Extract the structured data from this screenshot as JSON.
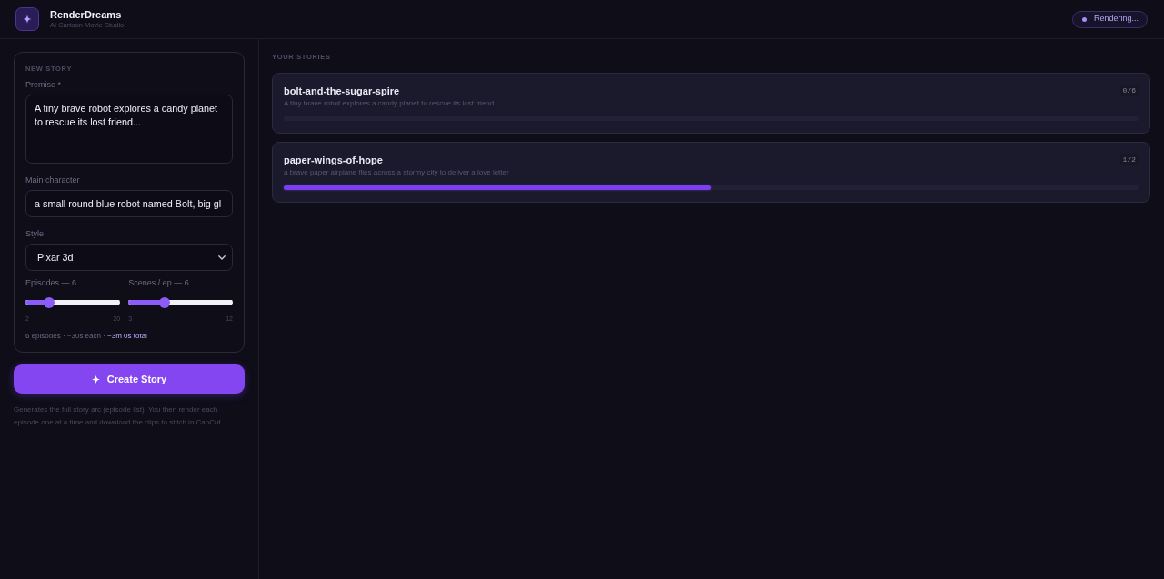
{
  "header": {
    "app_name": "RenderDreams",
    "tagline": "AI Cartoon Movie Studio",
    "status": "Rendering..."
  },
  "new_story": {
    "heading": "NEW STORY",
    "fields": [
      {
        "kind": "textarea",
        "label": "Premise *",
        "value": "A tiny brave robot explores a candy planet to rescue its lost friend..."
      },
      {
        "kind": "text",
        "label": "Main character",
        "value": "a small round blue robot named Bolt, big gl"
      },
      {
        "kind": "select",
        "label": "Style",
        "value": "Pixar 3d"
      }
    ],
    "sliders": [
      {
        "label": "Episodes — 6",
        "level": 0.22,
        "min": "2",
        "max": "20"
      },
      {
        "label": "Scenes / ep — 6",
        "level": 0.33,
        "min": "3",
        "max": "12"
      }
    ],
    "summary": "6 episodes · ~30s each · **~3m 0s total**"
  },
  "create_button": "Create Story",
  "help_text": "Generates the full story arc (episode list). You then render each episode one at a time and download the clips to stitch in CapCut.",
  "stories": {
    "heading": "YOUR STORIES",
    "items": [
      {
        "title": "bolt-and-the-sugar-spire",
        "description": "A tiny brave robot explores a candy planet to rescue its lost friend...",
        "progress": "0/6",
        "level": 0
      },
      {
        "title": "paper-wings-of-hope",
        "description": "a brave paper airplane flies across a stormy city to deliver a love letter",
        "progress": "1/2",
        "level": 0.5
      }
    ]
  }
}
